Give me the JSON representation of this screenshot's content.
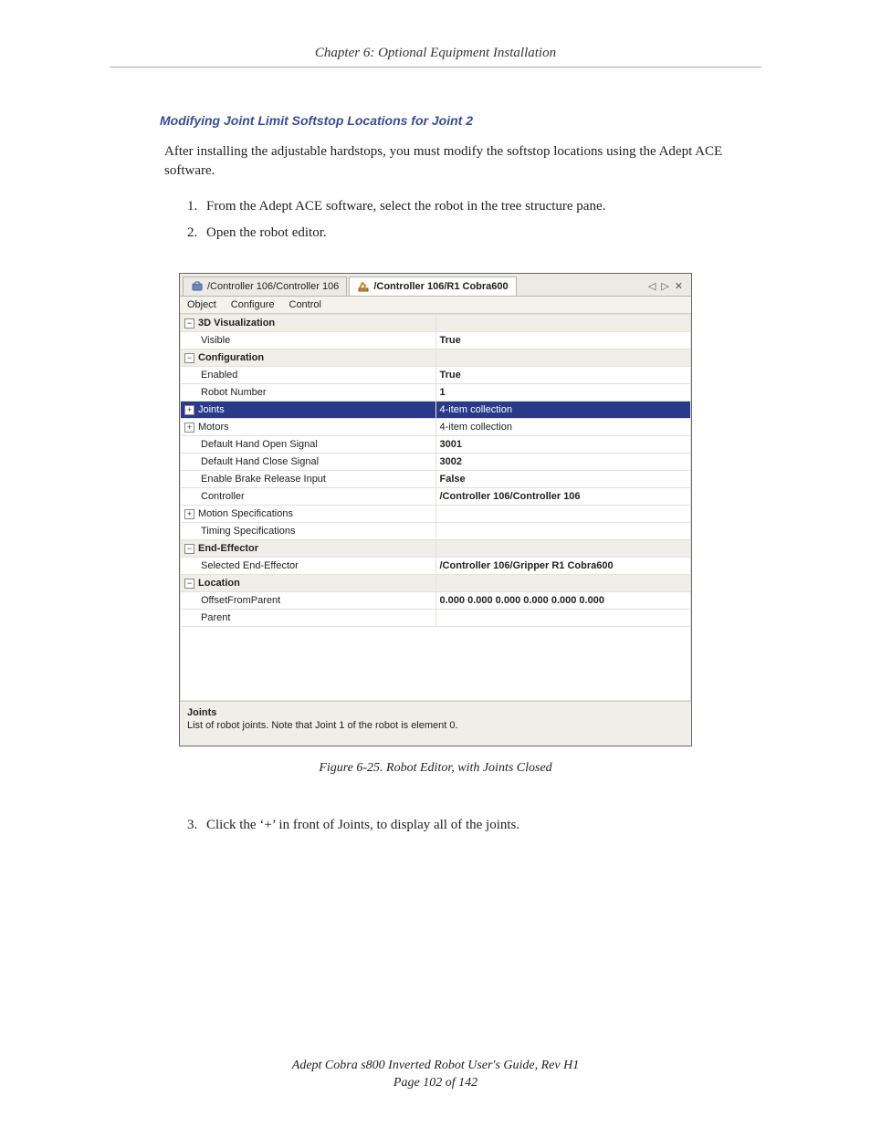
{
  "header": {
    "chapter_title": "Chapter 6: Optional Equipment Installation"
  },
  "section": {
    "heading": "Modifying Joint Limit Softstop Locations for Joint 2",
    "intro": "After installing the adjustable hardstops, you must modify the softstop locations using the Adept ACE software.",
    "steps": [
      "From the Adept ACE software, select the robot in the tree structure pane.",
      "Open the robot editor."
    ],
    "step3": "Click the ‘+’ in front of Joints, to display all of the joints."
  },
  "editor": {
    "tabs": [
      {
        "label": "/Controller 106/Controller 106",
        "active": false
      },
      {
        "label": "/Controller 106/R1 Cobra600",
        "active": true
      }
    ],
    "tab_controls": {
      "prev": "◁",
      "next": "▷",
      "close": "✕"
    },
    "menubar": [
      "Object",
      "Configure",
      "Control"
    ],
    "rows": [
      {
        "kind": "cat",
        "toggle": "-",
        "label": "3D Visualization",
        "value": ""
      },
      {
        "kind": "row",
        "indent": 1,
        "label": "Visible",
        "value": "True"
      },
      {
        "kind": "cat",
        "toggle": "-",
        "label": "Configuration",
        "value": ""
      },
      {
        "kind": "row",
        "indent": 1,
        "label": "Enabled",
        "value": "True"
      },
      {
        "kind": "row",
        "indent": 1,
        "label": "Robot Number",
        "value": "1"
      },
      {
        "kind": "sel",
        "toggle": "+",
        "indent": 1,
        "label": "Joints",
        "value": "4-item collection"
      },
      {
        "kind": "row",
        "toggle": "+",
        "indent": 1,
        "label": "Motors",
        "value": "4-item collection"
      },
      {
        "kind": "row",
        "indent": 1,
        "label": "Default Hand Open Signal",
        "value": "3001"
      },
      {
        "kind": "row",
        "indent": 1,
        "label": "Default Hand Close Signal",
        "value": "3002"
      },
      {
        "kind": "row",
        "indent": 1,
        "label": "Enable Brake Release Input",
        "value": "False"
      },
      {
        "kind": "row",
        "indent": 1,
        "label": "Controller",
        "value": "/Controller 106/Controller 106"
      },
      {
        "kind": "row",
        "toggle": "+",
        "indent": 1,
        "label": "Motion Specifications",
        "value": ""
      },
      {
        "kind": "row",
        "indent": 1,
        "label": "Timing Specifications",
        "value": ""
      },
      {
        "kind": "cat",
        "toggle": "-",
        "label": "End-Effector",
        "value": ""
      },
      {
        "kind": "row",
        "indent": 1,
        "label": "Selected End-Effector",
        "value": "/Controller 106/Gripper R1 Cobra600"
      },
      {
        "kind": "cat",
        "toggle": "-",
        "label": "Location",
        "value": ""
      },
      {
        "kind": "row",
        "indent": 1,
        "label": "OffsetFromParent",
        "value": "0.000 0.000 0.000 0.000 0.000 0.000"
      },
      {
        "kind": "row",
        "indent": 1,
        "label": "Parent",
        "value": ""
      }
    ],
    "desc": {
      "title": "Joints",
      "text": "List of robot joints. Note that Joint 1 of the robot is element 0."
    }
  },
  "figure_caption": "Figure 6-25. Robot Editor, with Joints Closed",
  "footer": {
    "line1": "Adept Cobra s800 Inverted Robot User's Guide, Rev H1",
    "line2": "Page 102 of 142"
  }
}
